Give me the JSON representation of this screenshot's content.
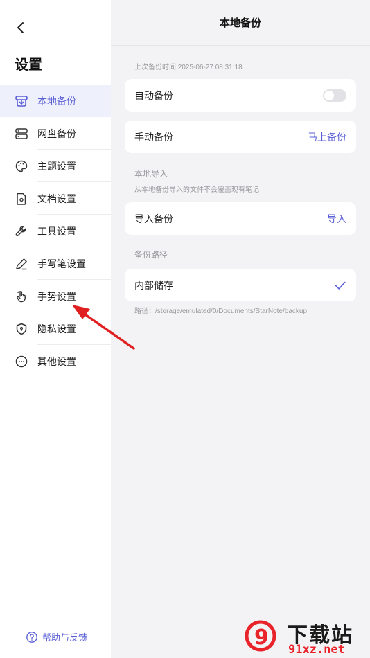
{
  "sidebar": {
    "title": "设置",
    "items": [
      {
        "label": "本地备份",
        "icon": "local-backup-icon",
        "active": true
      },
      {
        "label": "网盘备份",
        "icon": "cloud-drive-icon"
      },
      {
        "label": "主题设置",
        "icon": "palette-icon"
      },
      {
        "label": "文档设置",
        "icon": "document-settings-icon"
      },
      {
        "label": "工具设置",
        "icon": "wrench-icon"
      },
      {
        "label": "手写笔设置",
        "icon": "pen-icon"
      },
      {
        "label": "手势设置",
        "icon": "hand-gesture-icon"
      },
      {
        "label": "隐私设置",
        "icon": "shield-icon"
      },
      {
        "label": "其他设置",
        "icon": "more-circle-icon"
      }
    ],
    "help_label": "帮助与反馈"
  },
  "main": {
    "title": "本地备份",
    "last_backup": "上次备份时间:2025-06-27 08:31:18",
    "auto_backup_label": "自动备份",
    "auto_backup_on": false,
    "manual_backup_label": "手动备份",
    "manual_backup_action": "马上备份",
    "import_section": "本地导入",
    "import_note": "从本地备份导入的文件不会覆盖现有笔记",
    "import_label": "导入备份",
    "import_action": "导入",
    "path_section": "备份路径",
    "storage_label": "内部储存",
    "path_text": "路径：/storage/emulated/0/Documents/StarNote/backup"
  },
  "watermark": {
    "brand": "下载站",
    "domain": "91xz.net",
    "logo_text": "9"
  },
  "colors": {
    "accent": "#5a5fd6",
    "annotation_arrow": "#e02020",
    "watermark_red": "#e8232a"
  }
}
